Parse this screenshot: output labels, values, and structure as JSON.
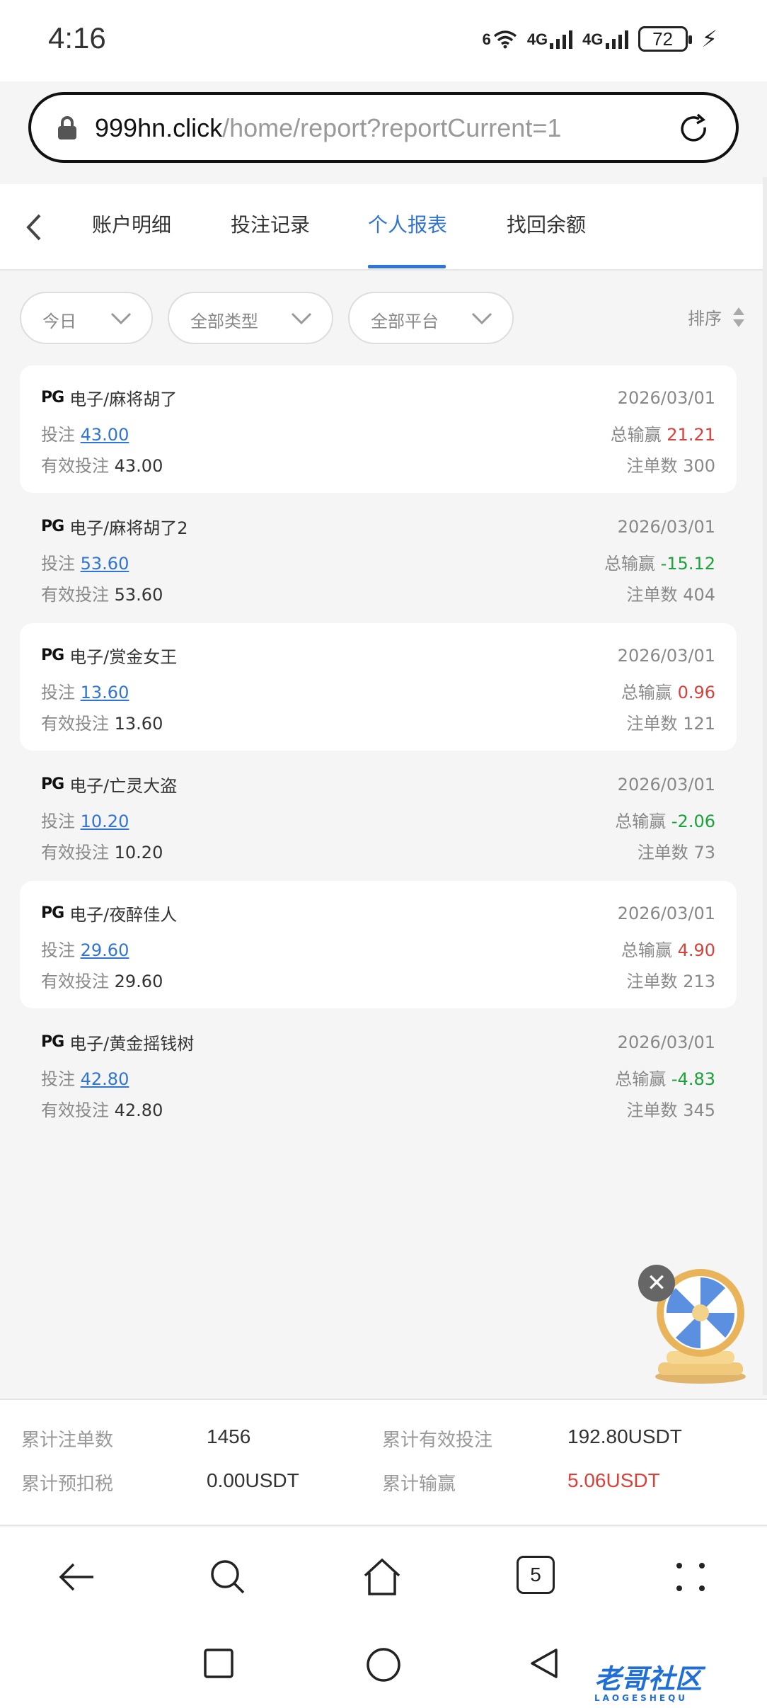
{
  "status": {
    "time": "4:16",
    "wifi_label": "6",
    "sim1_label": "4G",
    "sim2_label": "4G",
    "battery": "72"
  },
  "browser": {
    "url_domain": "999hn.click",
    "url_path": "/home/report?reportCurrent=1",
    "tab_count": "5"
  },
  "tabs": [
    {
      "label": "账户明细"
    },
    {
      "label": "投注记录"
    },
    {
      "label": "个人报表"
    },
    {
      "label": "找回余额"
    }
  ],
  "active_tab": "个人报表",
  "filters": {
    "date": "今日",
    "type": "全部类型",
    "platform": "全部平台",
    "sort": "排序"
  },
  "labels": {
    "bet": "投注",
    "valid_bet": "有效投注",
    "win_loss": "总输赢",
    "bet_count": "注单数",
    "brand": "PG"
  },
  "records": [
    {
      "game": "电子/麻将胡了",
      "date": "2026/03/01",
      "bet": "43.00",
      "win_loss": "21.21",
      "valid_bet": "43.00",
      "count": "300"
    },
    {
      "game": "电子/麻将胡了2",
      "date": "2026/03/01",
      "bet": "53.60",
      "win_loss": "-15.12",
      "valid_bet": "53.60",
      "count": "404"
    },
    {
      "game": "电子/赏金女王",
      "date": "2026/03/01",
      "bet": "13.60",
      "win_loss": "0.96",
      "valid_bet": "13.60",
      "count": "121"
    },
    {
      "game": "电子/亡灵大盗",
      "date": "2026/03/01",
      "bet": "10.20",
      "win_loss": "-2.06",
      "valid_bet": "10.20",
      "count": "73"
    },
    {
      "game": "电子/夜醉佳人",
      "date": "2026/03/01",
      "bet": "29.60",
      "win_loss": "4.90",
      "valid_bet": "29.60",
      "count": "213"
    },
    {
      "game": "电子/黄金摇钱树",
      "date": "2026/03/01",
      "bet": "42.80",
      "win_loss": "-4.83",
      "valid_bet": "42.80",
      "count": "345"
    }
  ],
  "summary": {
    "total_count_label": "累计注单数",
    "total_count": "1456",
    "total_valid_label": "累计有效投注",
    "total_valid": "192.80USDT",
    "total_tax_label": "累计预扣税",
    "total_tax": "0.00USDT",
    "total_wl_label": "累计输赢",
    "total_wl": "5.06USDT"
  },
  "watermark": {
    "text": "老哥社区",
    "sub": "LAOGESHEQU"
  },
  "colors": {
    "accent": "#2f74d6",
    "win": "#d9413a",
    "loss": "#1aa33a"
  }
}
